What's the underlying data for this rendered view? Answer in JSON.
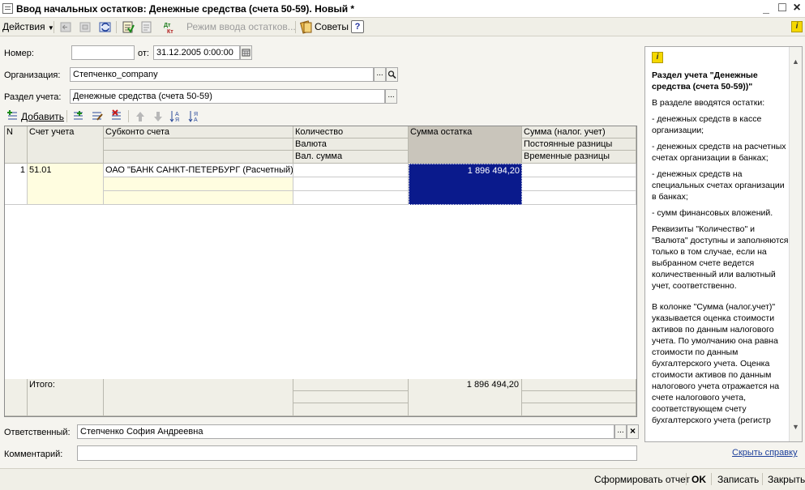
{
  "window": {
    "title": "Ввод начальных остатков: Денежные средства (счета 50-59). Новый *",
    "minimize": "_",
    "maximize": "□",
    "close": "×"
  },
  "toolbar": {
    "actions_label": "Действия",
    "input_mode_label": "Режим ввода остатков...",
    "tips_label": "Советы",
    "help_label": "?",
    "info_label": "i"
  },
  "form": {
    "number_label": "Номер:",
    "number_value": "",
    "from_label": "от:",
    "date_value": "31.12.2005  0:00:00",
    "org_label": "Организация:",
    "org_value": "Степченко_company",
    "section_label": "Раздел учета:",
    "section_value": "Денежные средства (счета 50-59)",
    "ellipsis": "...",
    "search_glyph": "🔍"
  },
  "grid_toolbar": {
    "add_label": "Добавить"
  },
  "grid": {
    "headers": {
      "n": "N",
      "account": "Счет учета",
      "subconto": "Субконто счета",
      "quantity": "Количество",
      "currency": "Валюта",
      "cur_sum": "Вал. сумма",
      "balance": "Сумма остатка",
      "tax_sum": "Сумма (налог. учет)",
      "const_diff": "Постоянные разницы",
      "temp_diff": "Временные разницы"
    },
    "rows": [
      {
        "n": "1",
        "account": "51.01",
        "subconto": "ОАО \"БАНК САНКТ-ПЕТЕРБУРГ (Расчетный)",
        "balance": "1 896 494,20"
      }
    ],
    "footer": {
      "total_label": "Итого:",
      "total_balance": "1 896 494,20"
    }
  },
  "responsible": {
    "label": "Ответственный:",
    "value": "Степченко София Андреевна"
  },
  "comment": {
    "label": "Комментарий:",
    "value": ""
  },
  "help": {
    "heading": "Раздел учета \"Денежные средства (счета 50-59))\"",
    "paragraphs": [
      "В разделе вводятся остатки:",
      "- денежных средств в кассе организации;",
      "- денежных средств на расчетных счетах организации в банках;",
      "- денежных средств на специальных счетах организации в банках;",
      "- сумм финансовых вложений.",
      "Реквизиты \"Количество\" и \"Валюта\" доступны и заполняются только в том случае, если на выбранном счете ведется количественный или валютный учет, соответственно.",
      "В колонке \"Сумма (налог.учет)\" указывается оценка стоимости активов по данным налогового учета. По умолчанию она равна стоимости по данным бухгалтерского учета. Оценка стоимости активов по данным налогового учета отражается на счете налогового учета, соответствующем счету бухгалтерского учета (регистр"
    ],
    "hide_link": "Скрыть справку"
  },
  "bottom": {
    "report_label": "Сформировать отчет",
    "ok_label": "OK",
    "save_label": "Записать",
    "close_label": "Закрыть"
  }
}
